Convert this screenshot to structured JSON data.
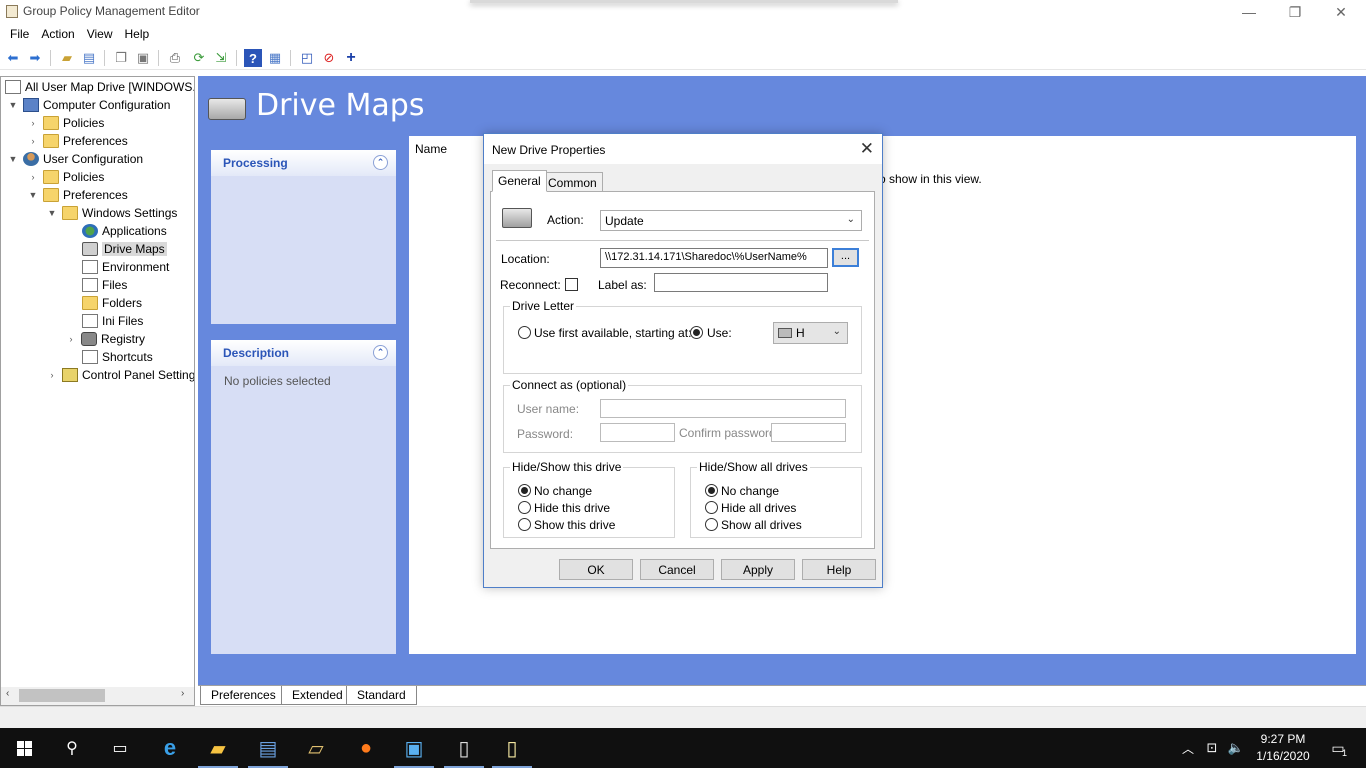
{
  "window": {
    "title": "Group Policy Management Editor",
    "minimize": "—",
    "restore": "❐",
    "close": "✕"
  },
  "menu": [
    "File",
    "Action",
    "View",
    "Help"
  ],
  "tree": {
    "root": "All User Map Drive [WINDOWS.\\",
    "items": [
      {
        "label": "Computer Configuration"
      },
      {
        "label": "Policies"
      },
      {
        "label": "Preferences"
      },
      {
        "label": "User Configuration"
      },
      {
        "label": "Policies"
      },
      {
        "label": "Preferences"
      },
      {
        "label": "Windows Settings"
      },
      {
        "label": "Applications"
      },
      {
        "label": "Drive Maps"
      },
      {
        "label": "Environment"
      },
      {
        "label": "Files"
      },
      {
        "label": "Folders"
      },
      {
        "label": "Ini Files"
      },
      {
        "label": "Registry"
      },
      {
        "label": "Shortcuts"
      },
      {
        "label": "Control Panel Setting"
      }
    ]
  },
  "main": {
    "title": "Drive Maps",
    "processing": {
      "title": "Processing"
    },
    "description": {
      "title": "Description",
      "text": "No policies selected"
    },
    "list": {
      "column": "Name",
      "empty": "o show in this view."
    }
  },
  "bottom_tabs": [
    "Preferences",
    "Extended",
    "Standard"
  ],
  "dialog": {
    "title": "New Drive Properties",
    "tabs": [
      "General",
      "Common"
    ],
    "action_label": "Action:",
    "action_value": "Update",
    "location_label": "Location:",
    "location_value": "\\\\172.31.14.171\\Sharedoc\\%UserName%",
    "browse": "...",
    "reconnect_label": "Reconnect:",
    "label_as": "Label as:",
    "drive_letter": {
      "title": "Drive Letter",
      "first_available": "Use first available, starting at:",
      "use": "Use:",
      "letter": "H"
    },
    "connect_as": {
      "title": "Connect as (optional)",
      "username": "User name:",
      "password": "Password:",
      "confirm": "Confirm password:"
    },
    "hide_this": {
      "title": "Hide/Show this drive",
      "options": [
        "No change",
        "Hide this drive",
        "Show this drive"
      ]
    },
    "hide_all": {
      "title": "Hide/Show all drives",
      "options": [
        "No change",
        "Hide all drives",
        "Show all drives"
      ]
    },
    "buttons": {
      "ok": "OK",
      "cancel": "Cancel",
      "apply": "Apply",
      "help": "Help"
    }
  },
  "taskbar": {
    "time": "9:27 PM",
    "date": "1/16/2020",
    "notification_count": "1"
  }
}
